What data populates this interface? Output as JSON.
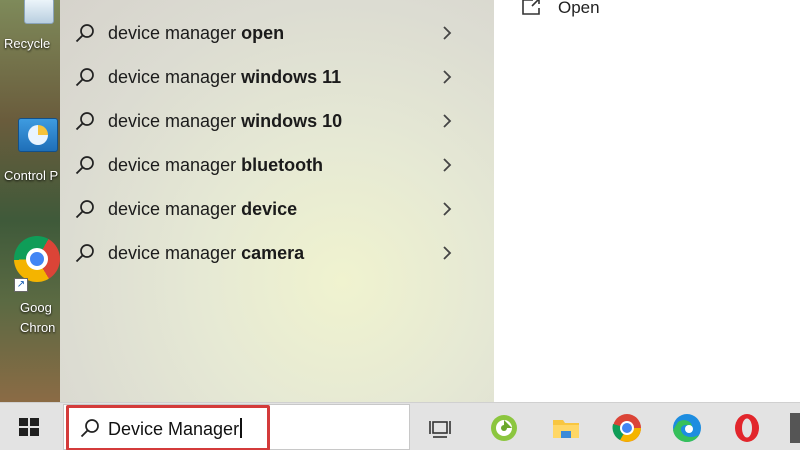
{
  "desktop": {
    "icons": [
      {
        "name": "recycle-bin",
        "label": "Recycle"
      },
      {
        "name": "control-panel",
        "label": "Control P"
      },
      {
        "name": "google-chrome",
        "label_line1": "Goog",
        "label_line2": "Chron"
      }
    ]
  },
  "search_results": {
    "suggestions": [
      {
        "prefix": "device manager ",
        "bold": "open"
      },
      {
        "prefix": "device manager ",
        "bold": "windows 11"
      },
      {
        "prefix": "device manager ",
        "bold": "windows 10"
      },
      {
        "prefix": "device manager ",
        "bold": "bluetooth"
      },
      {
        "prefix": "device manager ",
        "bold": "device"
      },
      {
        "prefix": "device manager ",
        "bold": "camera"
      }
    ],
    "right_pane": {
      "open_label": "Open"
    }
  },
  "taskbar": {
    "search_value": "Device Manager",
    "apps": [
      "windows-start-icon",
      "task-view-icon",
      "green-app-icon",
      "file-explorer-icon",
      "chrome-icon",
      "edge-icon",
      "opera-icon"
    ]
  },
  "colors": {
    "highlight": "#d43b3b",
    "taskbar": "#e3e3e3"
  }
}
